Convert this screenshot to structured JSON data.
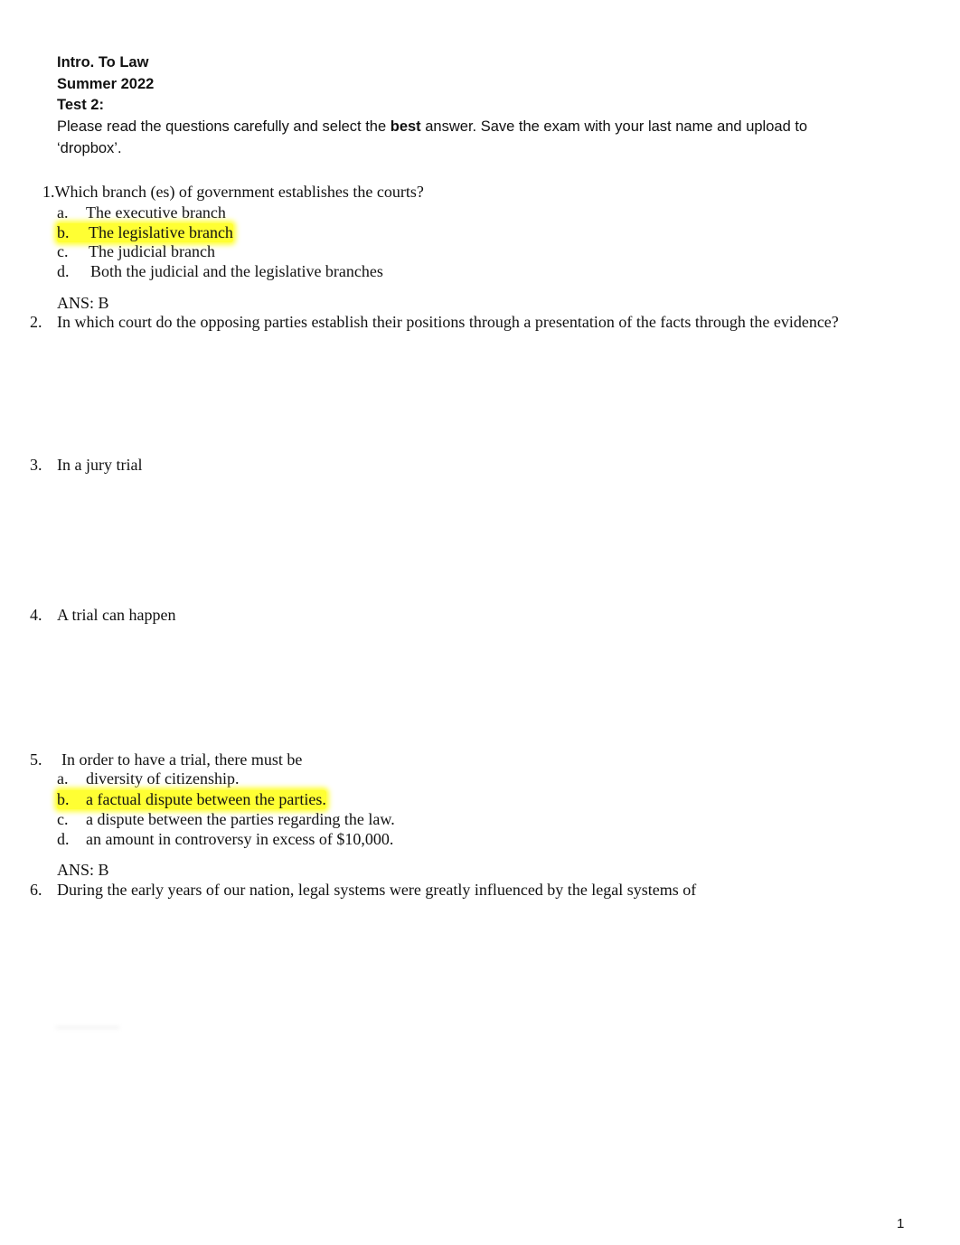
{
  "header": {
    "course": "Intro. To Law",
    "term": "Summer 2022",
    "test": "Test 2:",
    "instructions_pre": "Please read the questions carefully and select the ",
    "instructions_bold": "best",
    "instructions_post": " answer. Save the exam with your last name and upload to",
    "instructions_line2": "‘dropbox’."
  },
  "questions": [
    {
      "number": "1.",
      "text": "Which branch (es) of government establishes the courts?",
      "options": [
        {
          "letter": "a.",
          "text": "The executive branch"
        },
        {
          "letter": "b.",
          "text": "The legislative branch"
        },
        {
          "letter": "c.",
          "text": "The judicial branch"
        },
        {
          "letter": "d.",
          "text": "Both the judicial and the legislative branches"
        }
      ],
      "highlighted_option": "b",
      "answer": "ANS: B"
    },
    {
      "number": "2.",
      "text": "In which court do the opposing parties establish their positions through a presentation of the facts through the evidence?"
    },
    {
      "number": "3.",
      "text": "In a jury trial"
    },
    {
      "number": "4.",
      "text": "A trial can happen"
    },
    {
      "number": "5.",
      "text": "In order to have a trial, there must be",
      "options": [
        {
          "letter": "a.",
          "text": "diversity of citizenship."
        },
        {
          "letter": "b.",
          "text": "a factual dispute between the parties."
        },
        {
          "letter": "c.",
          "text": "a dispute between the parties regarding the law."
        },
        {
          "letter": "d.",
          "text": "an amount in controversy in excess of $10,000."
        }
      ],
      "highlighted_option": "b",
      "answer": "ANS: B"
    },
    {
      "number": "6.",
      "text": "During the early years of our nation, legal systems were greatly influenced by the legal systems of"
    }
  ],
  "footer": {
    "page_number": "1"
  },
  "colors": {
    "highlight": "#ffff33"
  }
}
